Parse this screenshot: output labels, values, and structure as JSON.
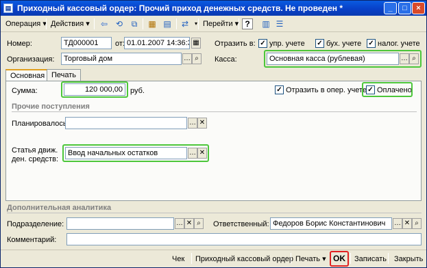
{
  "window": {
    "title": "Приходный кассовый ордер: Прочий приход денежных средств. Не проведен *",
    "minimize": "_",
    "maximize": "□",
    "close": "×"
  },
  "toolbar": {
    "operation": "Операция ▾",
    "actions": "Действия ▾",
    "goto": "Перейти ▾",
    "help": "?"
  },
  "header": {
    "number_label": "Номер:",
    "number": "ТД000001",
    "date_label": "от:",
    "date": "01.01.2007 14:36:32",
    "reflect_label": "Отразить в:",
    "upr": "упр. учете",
    "buh": "бух. учете",
    "nalog": "налог. учете",
    "org_label": "Организация:",
    "org": "Торговый дом",
    "kassa_label": "Касса:",
    "kassa": "Основная касса (рублевая)"
  },
  "tabs": [
    "Основная",
    "Печать"
  ],
  "main": {
    "sum_label": "Сумма:",
    "sum": "120 000,00",
    "currency": "руб.",
    "oper_label": "Отразить в опер. учете",
    "paid_label": "Оплачено",
    "section_other": "Прочие поступления",
    "planned_label": "Планировалось:",
    "planned": "",
    "article_label1": "Статья движ.",
    "article_label2": "ден. средств:",
    "article": "Ввод начальных остатков"
  },
  "extra": {
    "section": "Дополнительная аналитика",
    "dept_label": "Подразделение:",
    "dept": "",
    "resp_label": "Ответственный:",
    "resp": "Федоров Борис Константинович",
    "comment_label": "Комментарий:",
    "comment": ""
  },
  "bottom": {
    "check": "Чек",
    "pko": "Приходный кассовый ордер",
    "print": "Печать ▾",
    "ok": "OK",
    "save": "Записать",
    "close": "Закрыть"
  }
}
